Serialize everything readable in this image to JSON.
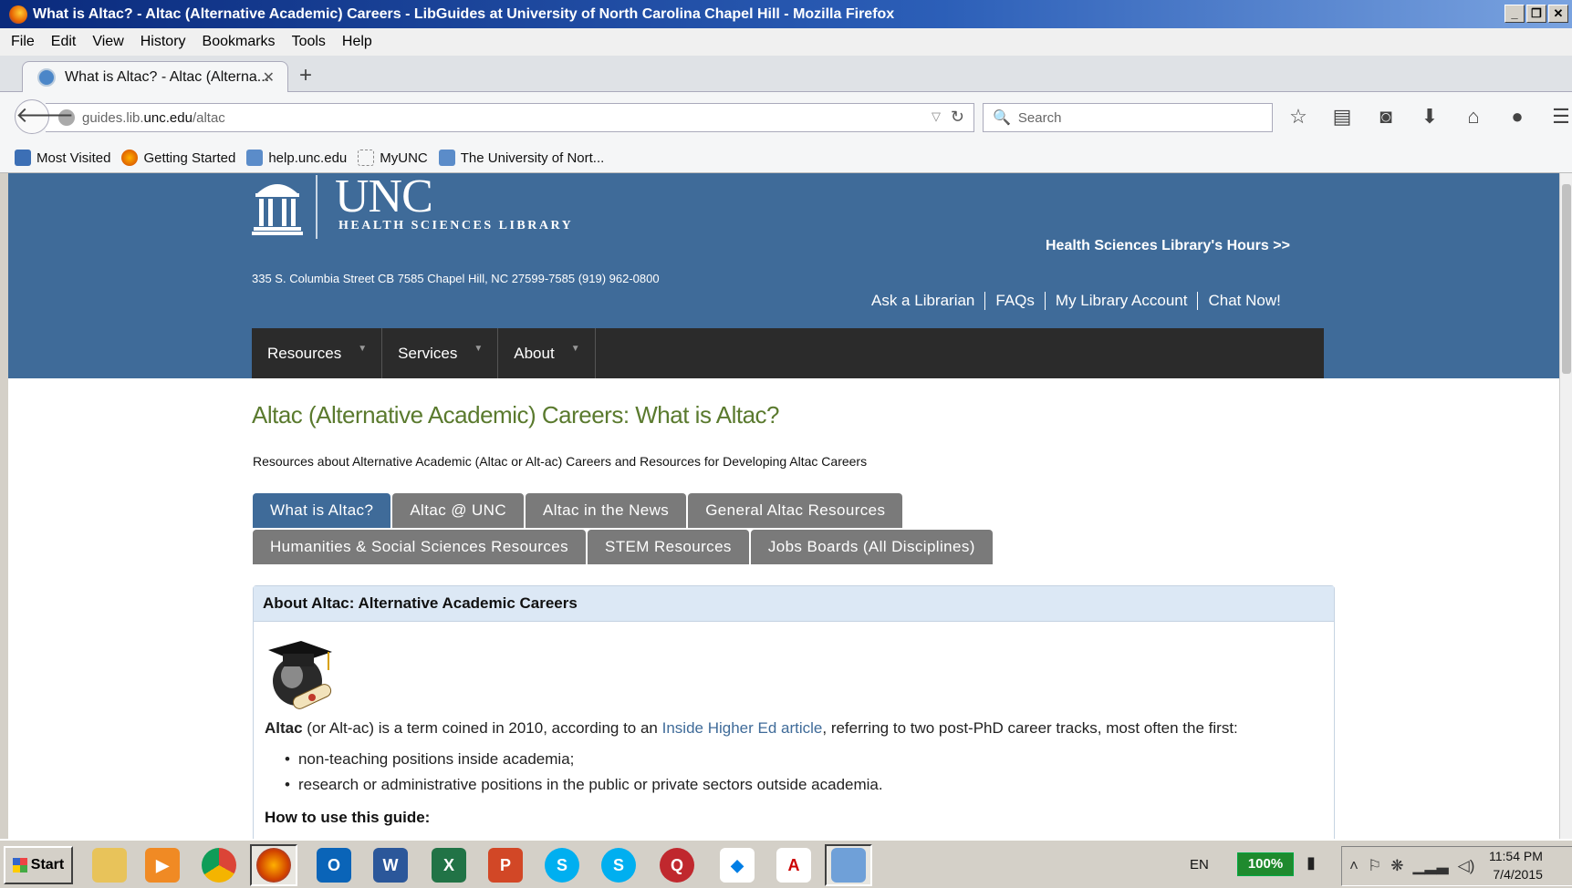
{
  "window": {
    "title": "What is Altac? - Altac (Alternative Academic) Careers - LibGuides at University of North Carolina Chapel Hill - Mozilla Firefox"
  },
  "menubar": [
    "File",
    "Edit",
    "View",
    "History",
    "Bookmarks",
    "Tools",
    "Help"
  ],
  "tab": {
    "label": "What is Altac? - Altac (Alterna...",
    "close_glyph": "✕",
    "new_tab_glyph": "+"
  },
  "navbar": {
    "url_prefix": "guides.lib.",
    "url_host": "unc.edu",
    "url_path": "/altac",
    "search_placeholder": "Search"
  },
  "bookmarks": [
    {
      "label": "Most Visited",
      "icon": "most-visited-icon"
    },
    {
      "label": "Getting Started",
      "icon": "firefox-icon"
    },
    {
      "label": "help.unc.edu",
      "icon": "unc-icon"
    },
    {
      "label": "MyUNC",
      "icon": "blank-page-icon"
    },
    {
      "label": "The University of Nort...",
      "icon": "unc-icon"
    }
  ],
  "site": {
    "logo_title": "UNC",
    "logo_subtitle": "HEALTH SCIENCES LIBRARY",
    "hours_link": "Health Sciences Library's Hours >>",
    "address": "335 S. Columbia Street CB 7585 Chapel Hill, NC 27599-7585   (919) 962-0800",
    "quick_links": [
      "Ask a Librarian",
      "FAQs",
      "My Library Account",
      "Chat Now!"
    ],
    "nav": [
      "Resources",
      "Services",
      "About"
    ],
    "colors": {
      "header": "#3f6b99",
      "nav": "#2b2b2b",
      "title": "#5a7a2e"
    }
  },
  "guide": {
    "title": "Altac (Alternative Academic) Careers: What is Altac?",
    "description": "Resources about Alternative Academic (Altac or Alt-ac) Careers and Resources for Developing Altac Careers",
    "tabs_row1": [
      "What is Altac?",
      "Altac @ UNC",
      "Altac in the News",
      "General Altac Resources"
    ],
    "tabs_row2": [
      "Humanities & Social Sciences Resources",
      "STEM Resources",
      "Jobs Boards (All Disciplines)"
    ],
    "active_tab": "What is Altac?"
  },
  "box": {
    "header": "About Altac: Alternative Academic Careers",
    "intro_term": "Altac",
    "intro_pre": " (or Alt-ac) is a term coined in 2010, according to an ",
    "intro_link": "Inside Higher Ed article",
    "intro_post": ", referring to two post-PhD career tracks, most often the first:",
    "bullets": [
      "non-teaching positions inside academia;",
      "research or administrative positions in the public or private sectors outside academia."
    ],
    "howto": "How to use this guide:"
  },
  "taskbar": {
    "start": "Start",
    "apps": [
      "file-explorer-icon",
      "media-player-icon",
      "chrome-icon",
      "firefox-icon",
      "outlook-icon",
      "word-icon",
      "excel-icon",
      "powerpoint-icon",
      "skype-icon",
      "skype-icon",
      "quicktime-icon",
      "dropbox-icon",
      "acrobat-icon",
      "control-panel-icon"
    ],
    "language": "EN",
    "battery": "100%",
    "time": "11:54 PM",
    "date": "7/4/2015"
  }
}
